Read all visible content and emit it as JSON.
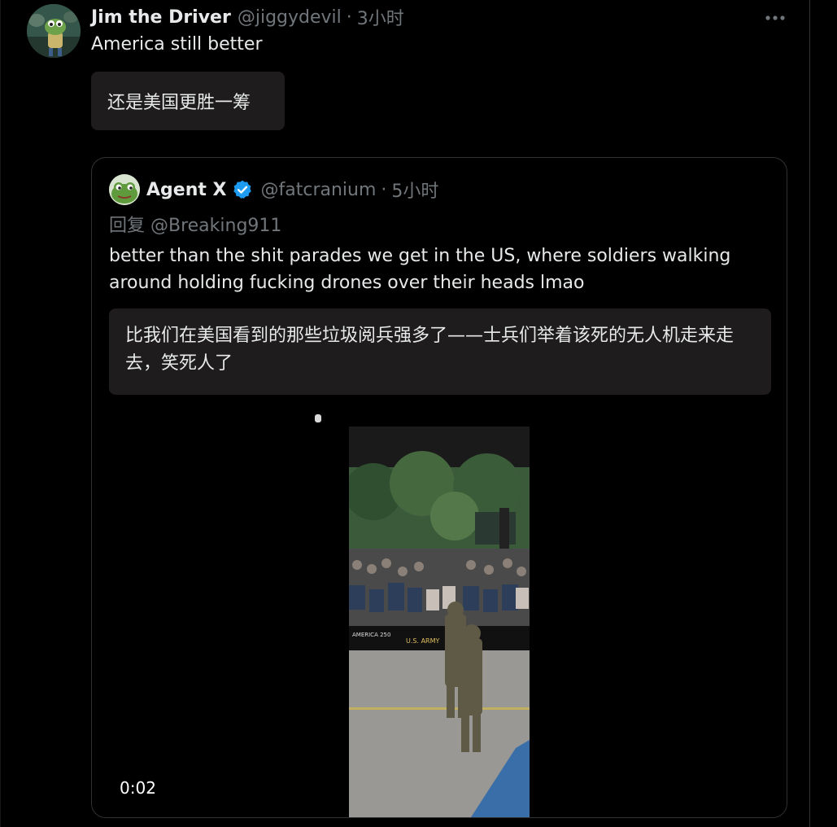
{
  "outer_tweet": {
    "display_name": "Jim the Driver",
    "handle": "@jiggydevil",
    "separator": "·",
    "time": "3小时",
    "text": "America still better",
    "translation": "还是美国更胜一筹",
    "more_icon": "more-horizontal-icon"
  },
  "quoted_tweet": {
    "display_name": "Agent X",
    "verified_icon": "verified-badge-icon",
    "handle": "@fatcranium",
    "separator": "·",
    "time": "5小时",
    "reply_to": "回复 @Breaking911",
    "text": "better than the shit parades we get in the US, where soldiers walking around holding fucking drones over their heads lmao",
    "translation": "比我们在美国看到的那些垃圾阅兵强多了——士兵们举着该死的无人机走来走去，笑死人了",
    "video": {
      "timestamp": "0:02",
      "banner_text": "AMERICA 250",
      "banner_text_2": "U.S. ARMY"
    }
  },
  "colors": {
    "background": "#000000",
    "text_primary": "#e7e9ea",
    "text_secondary": "#71767b",
    "translation_bg": "#1e1c1c",
    "border": "#2f3336",
    "verified_blue": "#1d9bf0"
  }
}
